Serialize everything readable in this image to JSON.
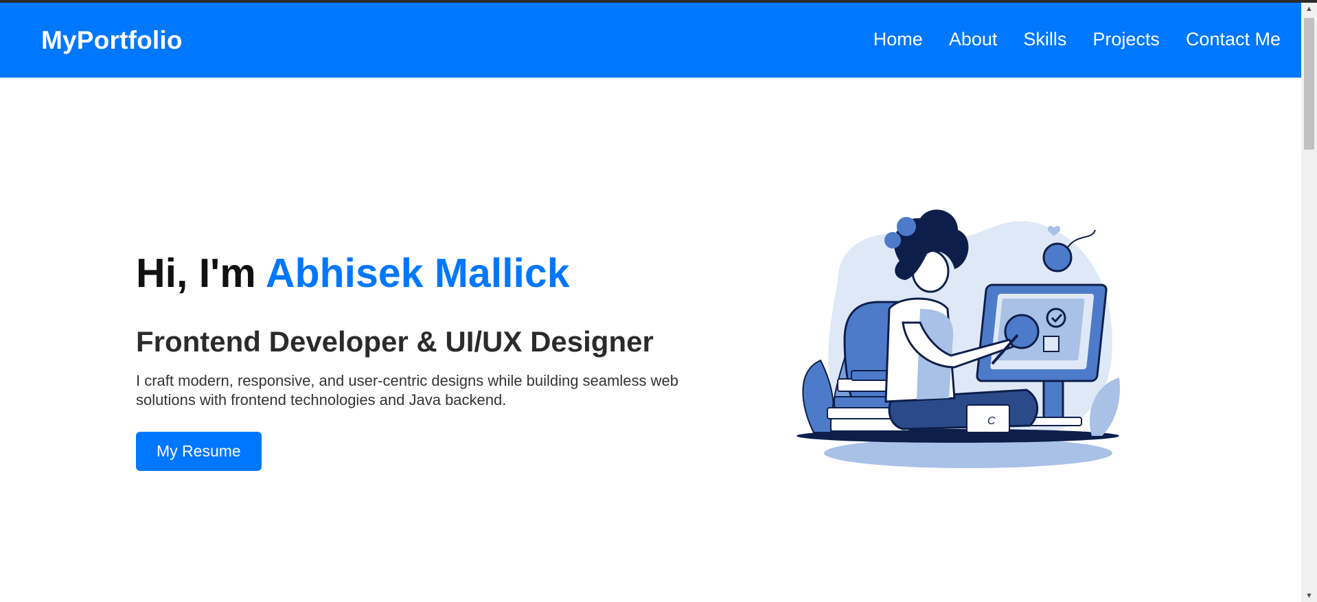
{
  "header": {
    "brand": "MyPortfolio",
    "nav": [
      "Home",
      "About",
      "Skills",
      "Projects",
      "Contact Me"
    ]
  },
  "hero": {
    "greeting_prefix": "Hi, I'm ",
    "name": "Abhisek Mallick",
    "role": "Frontend Developer & UI/UX Designer",
    "description": "I craft modern, responsive, and user-centric designs while building seamless web solutions with frontend technologies and Java backend.",
    "button_label": "My Resume",
    "illustration": {
      "book_label": "C"
    }
  },
  "colors": {
    "accent": "#0077ff",
    "navbar": "#0077ff",
    "text_dark": "#111111",
    "illustration_dark": "#0d1e4a",
    "illustration_mid": "#4d7bc9",
    "illustration_light": "#dfe8f7"
  },
  "icons": [
    "scroll-up-arrow-icon",
    "scroll-down-arrow-icon"
  ]
}
